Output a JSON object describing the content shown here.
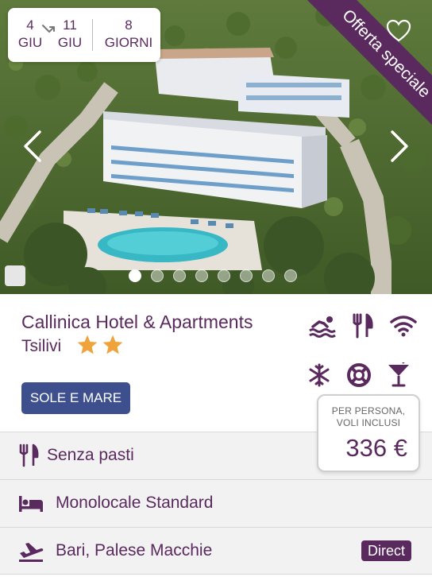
{
  "dates": {
    "start_day": "4",
    "start_month": "GIU",
    "end_day": "11",
    "end_month": "GIU",
    "nights_count": "8",
    "nights_label": "GIORNI"
  },
  "ribbon": {
    "text": "Offerta speciale"
  },
  "carousel": {
    "total_slides": 8,
    "active_slide": 1
  },
  "hotel": {
    "name": "Callinica Hotel & Apartments",
    "city": "Tsilivi",
    "stars": 2
  },
  "amenities": [
    "swimming-pool",
    "restaurant",
    "wifi",
    "air-conditioning",
    "lifeguard",
    "bar"
  ],
  "tag": {
    "label": "SOLE E MARE"
  },
  "price": {
    "label_line1": "PER PERSONA,",
    "label_line2": "VOLI INCLUSI",
    "value": "336 €"
  },
  "details": {
    "board": "Senza pasti",
    "room": "Monolocale Standard",
    "flight_from": "Bari, Palese Macchie",
    "flight_badge": "Direct"
  },
  "colors": {
    "brand": "#5a2a5e",
    "button": "#3d4f8c",
    "star": "#f0a33a",
    "row_bg": "#f2f2f2"
  }
}
